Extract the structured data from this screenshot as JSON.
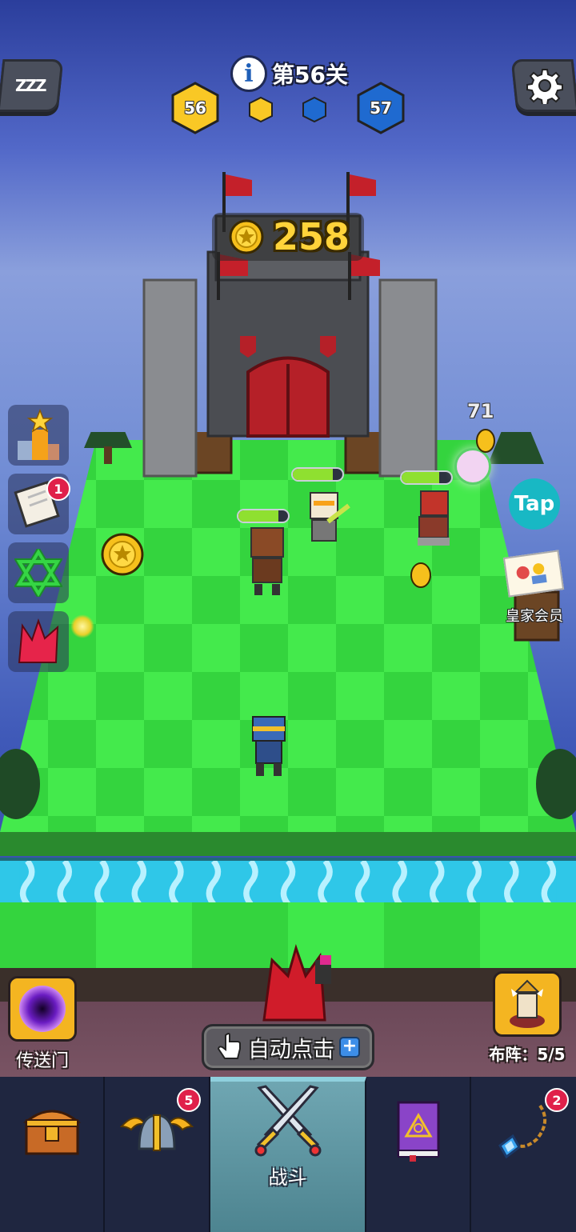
{
  "hud": {
    "level_label": "第56关",
    "current_level": "56",
    "next_level": "57",
    "info_icon": "i",
    "sleep_icon": "ZZZ"
  },
  "castle": {
    "coin_count": "258"
  },
  "board": {
    "enemy_number": "71"
  },
  "side_menu": {
    "quest_badge": "1"
  },
  "tap_bubble": "Tap",
  "vip": {
    "label": "皇家会员"
  },
  "portal": {
    "label": "传送门"
  },
  "formation": {
    "label": "布阵：",
    "value": "5/5"
  },
  "auto_tap": {
    "label": "自动点击",
    "plus": "+"
  },
  "nav": {
    "items": [
      {
        "name": "treasure",
        "icon": "treasure-chest-icon",
        "label": "",
        "badge": ""
      },
      {
        "name": "heroes",
        "icon": "winged-helmet-icon",
        "label": "",
        "badge": "5"
      },
      {
        "name": "battle",
        "icon": "crossed-swords-icon",
        "label": "战斗",
        "badge": ""
      },
      {
        "name": "spellbook",
        "icon": "spellbook-icon",
        "label": "",
        "badge": ""
      },
      {
        "name": "amulet",
        "icon": "amulet-icon",
        "label": "",
        "badge": "2"
      }
    ]
  },
  "colors": {
    "gold": "#ffd33a",
    "grass_light": "#3fe84a",
    "grass_dark": "#2fc63a",
    "water": "#2fc7e8",
    "badge_red": "#e0204a",
    "nav_bg": "#1f2640",
    "nav_active": "#5c95a1"
  }
}
